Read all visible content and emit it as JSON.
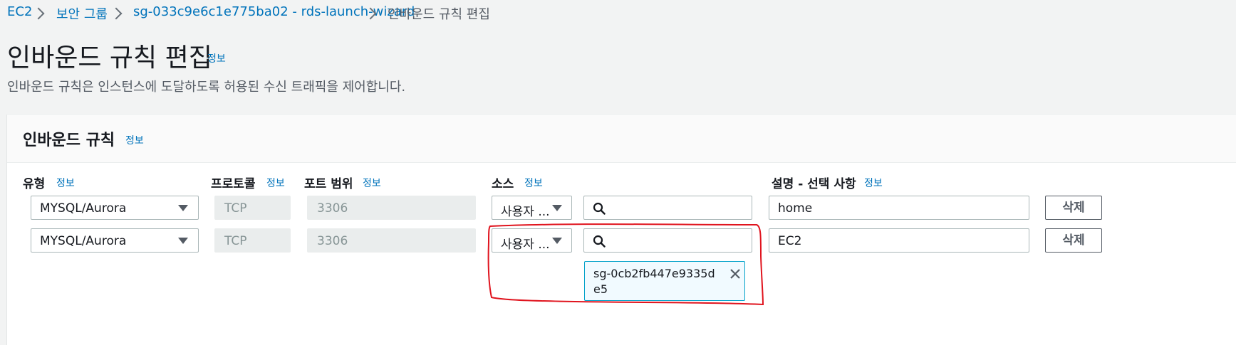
{
  "breadcrumb": {
    "items": [
      "EC2",
      "보안 그룹",
      "sg-033c9e6c1e775ba02 - rds-launch-wizard"
    ],
    "current": "인바운드 규칙 편집"
  },
  "page": {
    "title": "인바운드 규칙 편집",
    "info": "정보",
    "description": "인바운드 규칙은 인스턴스에 도달하도록 허용된 수신 트래픽을 제어합니다."
  },
  "panel": {
    "title": "인바운드 규칙",
    "info": "정보",
    "columns": {
      "type": "유형",
      "protocol": "프로토콜",
      "port": "포트 범위",
      "source": "소스",
      "description": "설명 - 선택 사항",
      "info": "정보"
    },
    "rows": [
      {
        "type": "MYSQL/Aurora",
        "protocol": "TCP",
        "port": "3306",
        "source_type": "사용자 ...",
        "source_search": "",
        "description": "home",
        "delete": "삭제"
      },
      {
        "type": "MYSQL/Aurora",
        "protocol": "TCP",
        "port": "3306",
        "source_type": "사용자 ...",
        "source_search": "",
        "description": "EC2",
        "delete": "삭제",
        "source_token": "sg-0cb2fb447e9335de5"
      }
    ]
  },
  "colors": {
    "link": "#0073bb",
    "annotation": "#e0141e",
    "token_border": "#00a1c9"
  },
  "icons": {
    "breadcrumb_separator": "chevron-right-icon",
    "dropdown": "caret-down-icon",
    "search": "search-icon",
    "remove": "close-icon"
  }
}
